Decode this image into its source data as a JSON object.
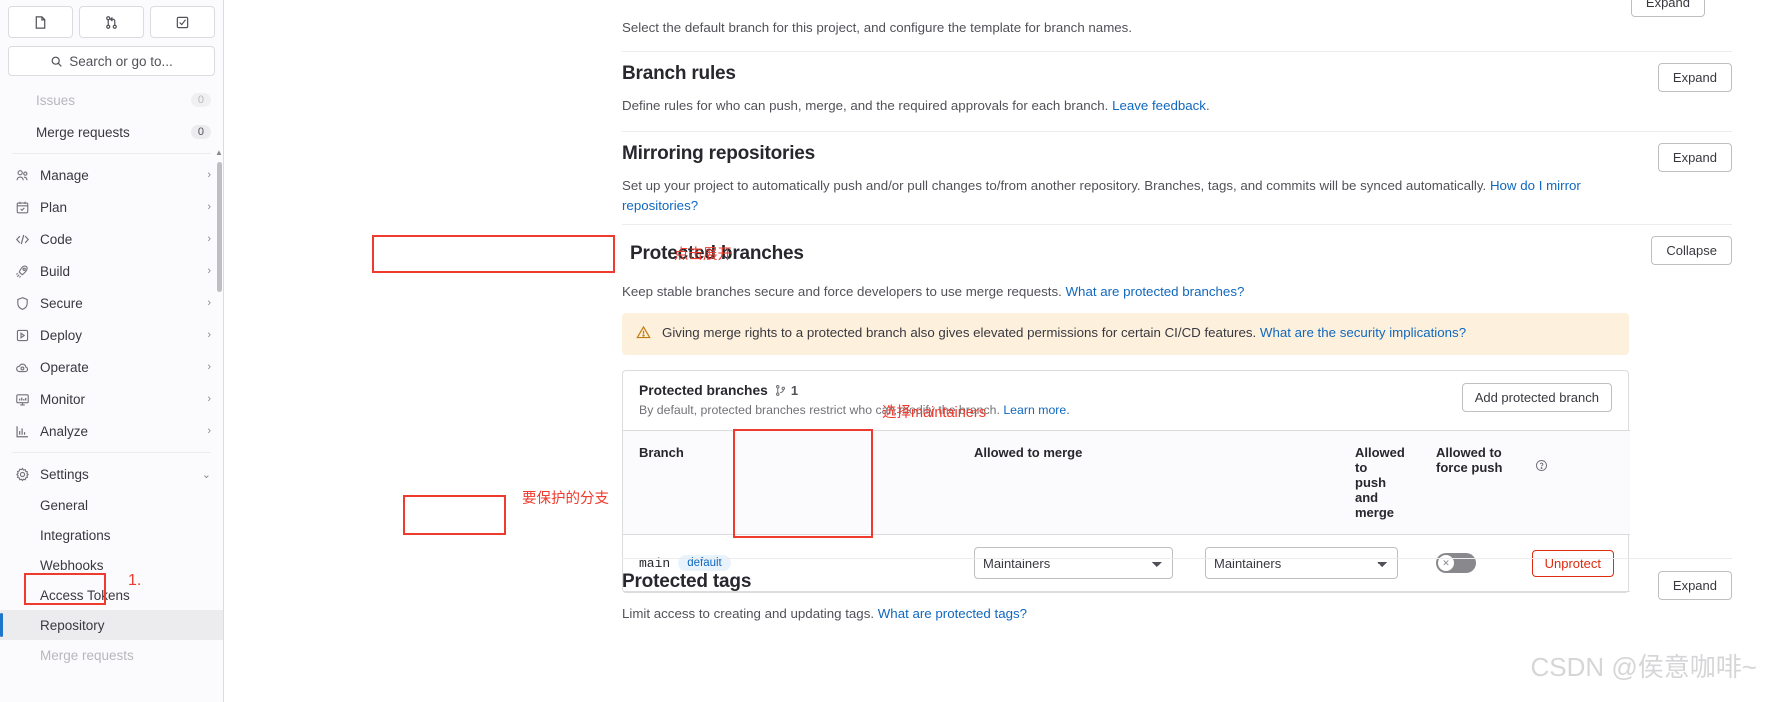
{
  "sidebar": {
    "context_buttons": [
      {
        "name": "project-icon",
        "glyph": "▯"
      },
      {
        "name": "merge-request-icon",
        "glyph": "⑂"
      },
      {
        "name": "todo-check-icon",
        "glyph": "☑"
      }
    ],
    "search": {
      "placeholder": "Search or go to...",
      "icon": "search-icon"
    },
    "top_items": [
      {
        "label": "Issues",
        "count": "0",
        "faded": true
      },
      {
        "label": "Merge requests",
        "count": "0",
        "faded": false
      }
    ],
    "groups": [
      {
        "label": "Manage",
        "icon": "users-icon",
        "chevron": "›"
      },
      {
        "label": "Plan",
        "icon": "calendar-icon",
        "chevron": "›"
      },
      {
        "label": "Code",
        "icon": "code-icon",
        "chevron": "›"
      },
      {
        "label": "Build",
        "icon": "rocket-icon",
        "chevron": "›"
      },
      {
        "label": "Secure",
        "icon": "shield-icon",
        "chevron": "›"
      },
      {
        "label": "Deploy",
        "icon": "deploy-icon",
        "chevron": "›"
      },
      {
        "label": "Operate",
        "icon": "cloud-gear-icon",
        "chevron": "›"
      },
      {
        "label": "Monitor",
        "icon": "monitor-icon",
        "chevron": "›"
      },
      {
        "label": "Analyze",
        "icon": "chart-icon",
        "chevron": "›"
      }
    ],
    "settings": {
      "label": "Settings",
      "icon": "gear-icon",
      "chevron": "⌄"
    },
    "settings_items": [
      {
        "label": "General",
        "active": false
      },
      {
        "label": "Integrations",
        "active": false
      },
      {
        "label": "Webhooks",
        "active": false
      },
      {
        "label": "Access Tokens",
        "active": false
      },
      {
        "label": "Repository",
        "active": true
      },
      {
        "label": "Merge requests",
        "active": false
      }
    ]
  },
  "main": {
    "default_branch_desc": "Select the default branch for this project, and configure the template for branch names.",
    "sections": [
      {
        "title": "Branch rules",
        "desc_prefix": "Define rules for who can push, merge, and the required approvals for each branch. ",
        "link": "Leave feedback",
        "desc_suffix": ".",
        "button": "Expand"
      },
      {
        "title": "Mirroring repositories",
        "desc_prefix": "Set up your project to automatically push and/or pull changes to/from another repository. Branches, tags, and commits will be synced automatically. ",
        "link": "How do I mirror repositories?",
        "desc_suffix": "",
        "button": "Expand"
      }
    ],
    "protected_branches": {
      "title": "Protected branches",
      "desc_prefix": "Keep stable branches secure and force developers to use merge requests. ",
      "desc_link": "What are protected branches?",
      "button": "Collapse",
      "alert": {
        "icon": "warning-icon",
        "text": "Giving merge rights to a protected branch also gives elevated permissions for certain CI/CD features. ",
        "link": "What are the security implications?"
      },
      "card": {
        "title": "Protected branches",
        "branch_icon": "branch-icon",
        "count": "1",
        "subtitle_prefix": "By default, protected branches restrict who can modify the branch. ",
        "subtitle_link": "Learn more.",
        "add_button": "Add protected branch",
        "columns": [
          "Branch",
          "Allowed to merge",
          "Allowed to push and merge",
          "Allowed to force push"
        ],
        "force_push_help_icon": "question-circle-icon",
        "rows": [
          {
            "branch": "main",
            "badge": "default",
            "allowed_to_merge": "Maintainers",
            "allowed_to_push_and_merge": "Maintainers",
            "force_push_enabled": false,
            "force_push_off_glyph": "✕",
            "action": "Unprotect"
          }
        ]
      }
    },
    "protected_tags": {
      "title": "Protected tags",
      "desc_prefix": "Limit access to creating and updating tags. ",
      "desc_link": "What are protected tags?",
      "button": "Expand"
    },
    "top_partial_button": "Expand"
  },
  "annotations": {
    "step_one": "1.",
    "click_expand": "点击展开",
    "select_maintainers": "选择maintainers",
    "protect_branch": "要保护的分支",
    "color": "#ef3b2d"
  },
  "watermark": "CSDN @侯意咖啡~"
}
